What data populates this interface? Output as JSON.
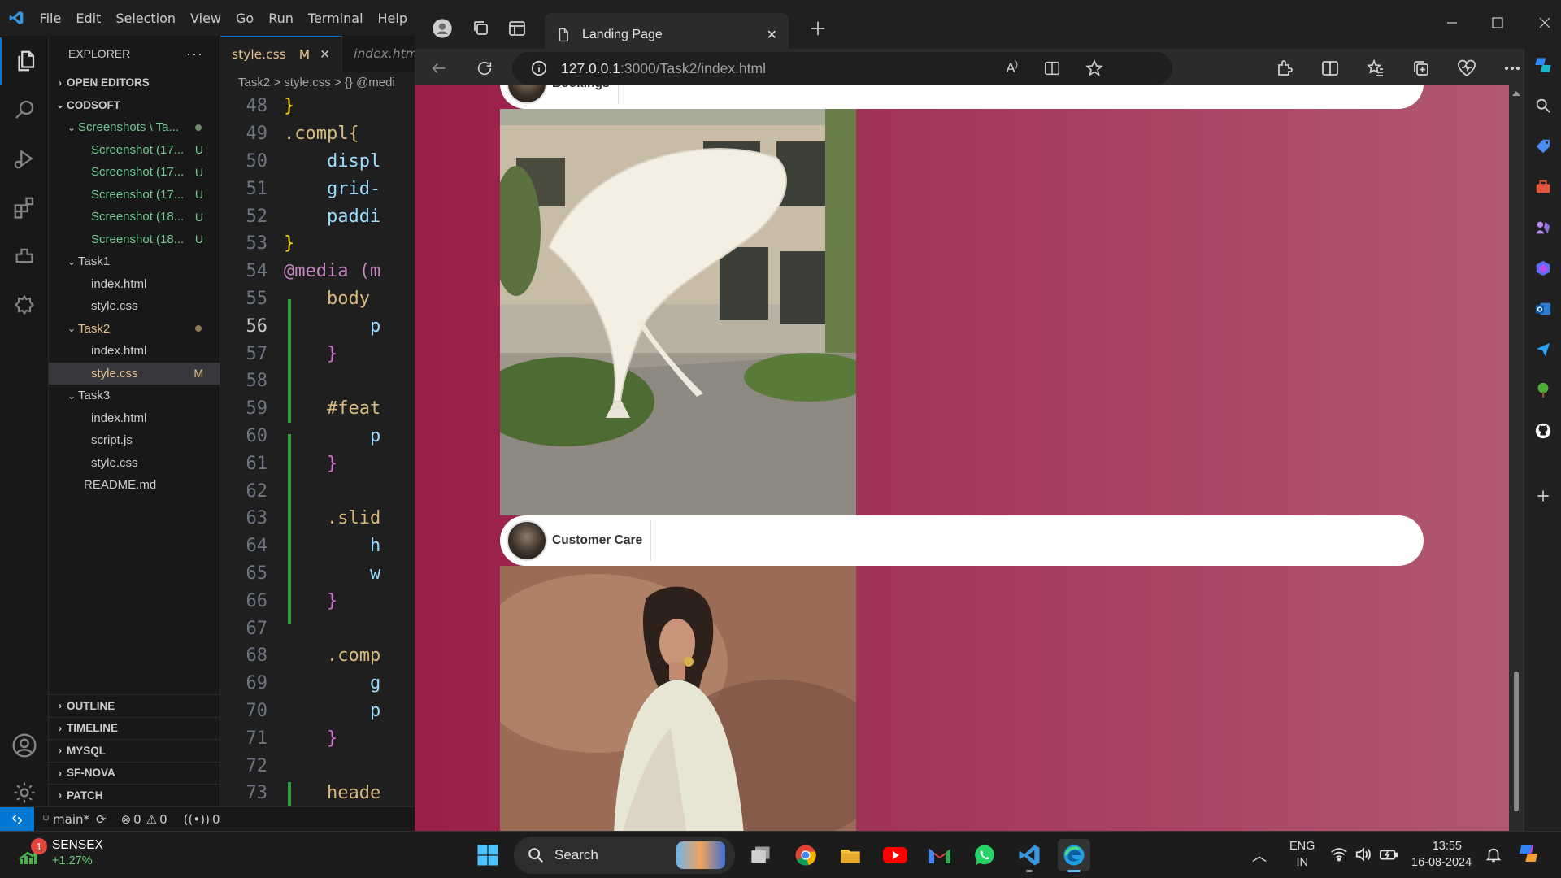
{
  "vscode": {
    "menu": [
      "File",
      "Edit",
      "Selection",
      "View",
      "Go",
      "Run",
      "Terminal",
      "Help"
    ],
    "explorer_title": "EXPLORER",
    "open_editors": "OPEN EDITORS",
    "root": "CODSOFT",
    "tree": {
      "screenshots_folder": "Screenshots \\ Ta...",
      "screenshots": [
        "Screenshot (17...",
        "Screenshot (17...",
        "Screenshot (17...",
        "Screenshot (18...",
        "Screenshot (18..."
      ],
      "untracked_badge": "U",
      "task1": "Task1",
      "task1_files": [
        "index.html",
        "style.css"
      ],
      "task2": "Task2",
      "task2_files": [
        "index.html",
        "style.css"
      ],
      "modified_badge": "M",
      "task3": "Task3",
      "task3_files": [
        "index.html",
        "script.js",
        "style.css"
      ],
      "readme": "README.md"
    },
    "bottom_sections": [
      "OUTLINE",
      "TIMELINE",
      "MYSQL",
      "SF-NOVA",
      "PATCH"
    ],
    "tabs": [
      {
        "label": "style.css",
        "badge": "M"
      },
      {
        "label": "index.htm"
      }
    ],
    "breadcrumbs": "Task2 > style.css > {} @medi",
    "current_line": "56",
    "code": [
      {
        "n": "48",
        "t": "}"
      },
      {
        "n": "49",
        "t": ".compl{"
      },
      {
        "n": "50",
        "t": "    displ"
      },
      {
        "n": "51",
        "t": "    grid-"
      },
      {
        "n": "52",
        "t": "    paddi"
      },
      {
        "n": "53",
        "t": "}"
      },
      {
        "n": "54",
        "t": "@media (m"
      },
      {
        "n": "55",
        "t": "    body "
      },
      {
        "n": "56",
        "t": "        p"
      },
      {
        "n": "57",
        "t": "    }"
      },
      {
        "n": "58",
        "t": ""
      },
      {
        "n": "59",
        "t": "    #feat"
      },
      {
        "n": "60",
        "t": "        p"
      },
      {
        "n": "61",
        "t": "    }"
      },
      {
        "n": "62",
        "t": ""
      },
      {
        "n": "63",
        "t": "    .slid"
      },
      {
        "n": "64",
        "t": "        h"
      },
      {
        "n": "65",
        "t": "        w"
      },
      {
        "n": "66",
        "t": "    }"
      },
      {
        "n": "67",
        "t": ""
      },
      {
        "n": "68",
        "t": "    .comp"
      },
      {
        "n": "69",
        "t": "        g"
      },
      {
        "n": "70",
        "t": "        p"
      },
      {
        "n": "71",
        "t": "    }"
      },
      {
        "n": "72",
        "t": ""
      },
      {
        "n": "73",
        "t": "    heade"
      }
    ],
    "status": {
      "branch": "main*",
      "errors": "0",
      "warnings": "0",
      "ports": "0"
    }
  },
  "edge": {
    "tab_title": "Landing Page",
    "url_host": "127.0.0.1",
    "url_rest": ":3000/Task2/index.html",
    "page": {
      "pill1_label": "Bookings",
      "pill2_label": "Customer Care"
    }
  },
  "taskbar": {
    "stock_name": "SENSEX",
    "stock_change": "+1.27%",
    "stock_badge": "1",
    "search_label": "Search",
    "lang1": "ENG",
    "lang2": "IN",
    "time": "13:55",
    "date": "16-08-2024"
  },
  "colors": {
    "vscode_accent": "#0078d4",
    "page_gradient_start": "#9a1f4a",
    "page_gradient_end": "#b15872",
    "git_added": "#2ea043"
  }
}
